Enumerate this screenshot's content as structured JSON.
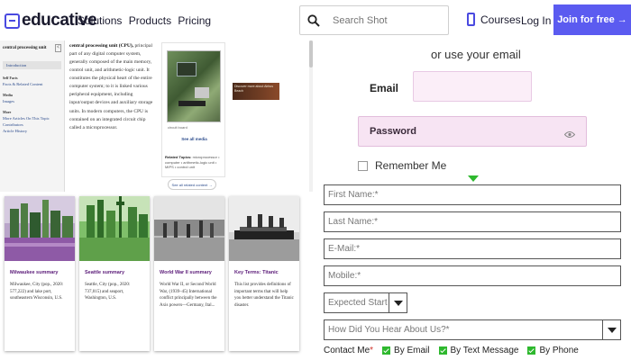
{
  "nav": {
    "logo_text": "educative",
    "links": [
      "Solutions",
      "Products",
      "Pricing"
    ],
    "search_placeholder": "Search Shot",
    "courses": "Courses",
    "login": "Log In",
    "join": "Join for free →",
    "accent": "#5b5bf0"
  },
  "encyclopedia": {
    "sidebar_title": "central processing unit",
    "sidebar_back": "<",
    "selected": "Introduction",
    "groups": [
      {
        "label": "Self Facts",
        "links": [
          "Facts & Related Content"
        ]
      },
      {
        "label": "Media",
        "links": [
          "Images"
        ]
      },
      {
        "label": "More",
        "links": [
          "More Articles On This Topic",
          "Contributors",
          "Article History"
        ]
      }
    ],
    "body_title": "central processing unit (CPU),",
    "body_text": "principal part of any digital computer system, generally composed of the main memory, control unit, and arithmetic-logic unit. It constitutes the physical heart of the entire computer system; to it is linked various peripheral equipment, including input/output devices and auxiliary storage units. In modern computers, the CPU is contained on an integrated circuit chip called a microprocessor.",
    "media_caption": "circuit board",
    "media_link": "See all media",
    "related_label": "Related Topics:",
    "related_text": "microprocessor • computer • arithmetic-logic unit • MIPS • control unit",
    "see_all": "See all related content →",
    "ad_text": "Discover more about Airbus Beach"
  },
  "cards": [
    {
      "title": "Milwaukee summary",
      "desc": "Milwaukee, City (pop., 2020: 577,222) and lake port, southeastern Wisconsin, U.S."
    },
    {
      "title": "Seattle summary",
      "desc": "Seattle, City (pop., 2020: 737,015) and seaport, Washington, U.S."
    },
    {
      "title": "World War II summary",
      "desc": "World War II, or Second World War, (1939–45) International conflict principally between the Axis powers—Germany, Ital..."
    },
    {
      "title": "Key Terms: Titanic",
      "desc": "This list provides definitions of important terms that will help you better understand the Titanic disaster."
    }
  ],
  "form": {
    "or_text": "or use your email",
    "email_label": "Email",
    "password_label": "Password",
    "remember": "Remember Me",
    "fields": [
      "First Name:*",
      "Last Name:*",
      "E-Mail:*",
      "Mobile:*"
    ],
    "start_select": "Expected Start Year",
    "hear_select": "How Did You Hear About Us?*",
    "contact_label": "Contact Me",
    "contact_required": "*",
    "contact_options": [
      "By Email",
      "By Text Message",
      "By Phone"
    ],
    "check_color": "#2eb82e"
  }
}
